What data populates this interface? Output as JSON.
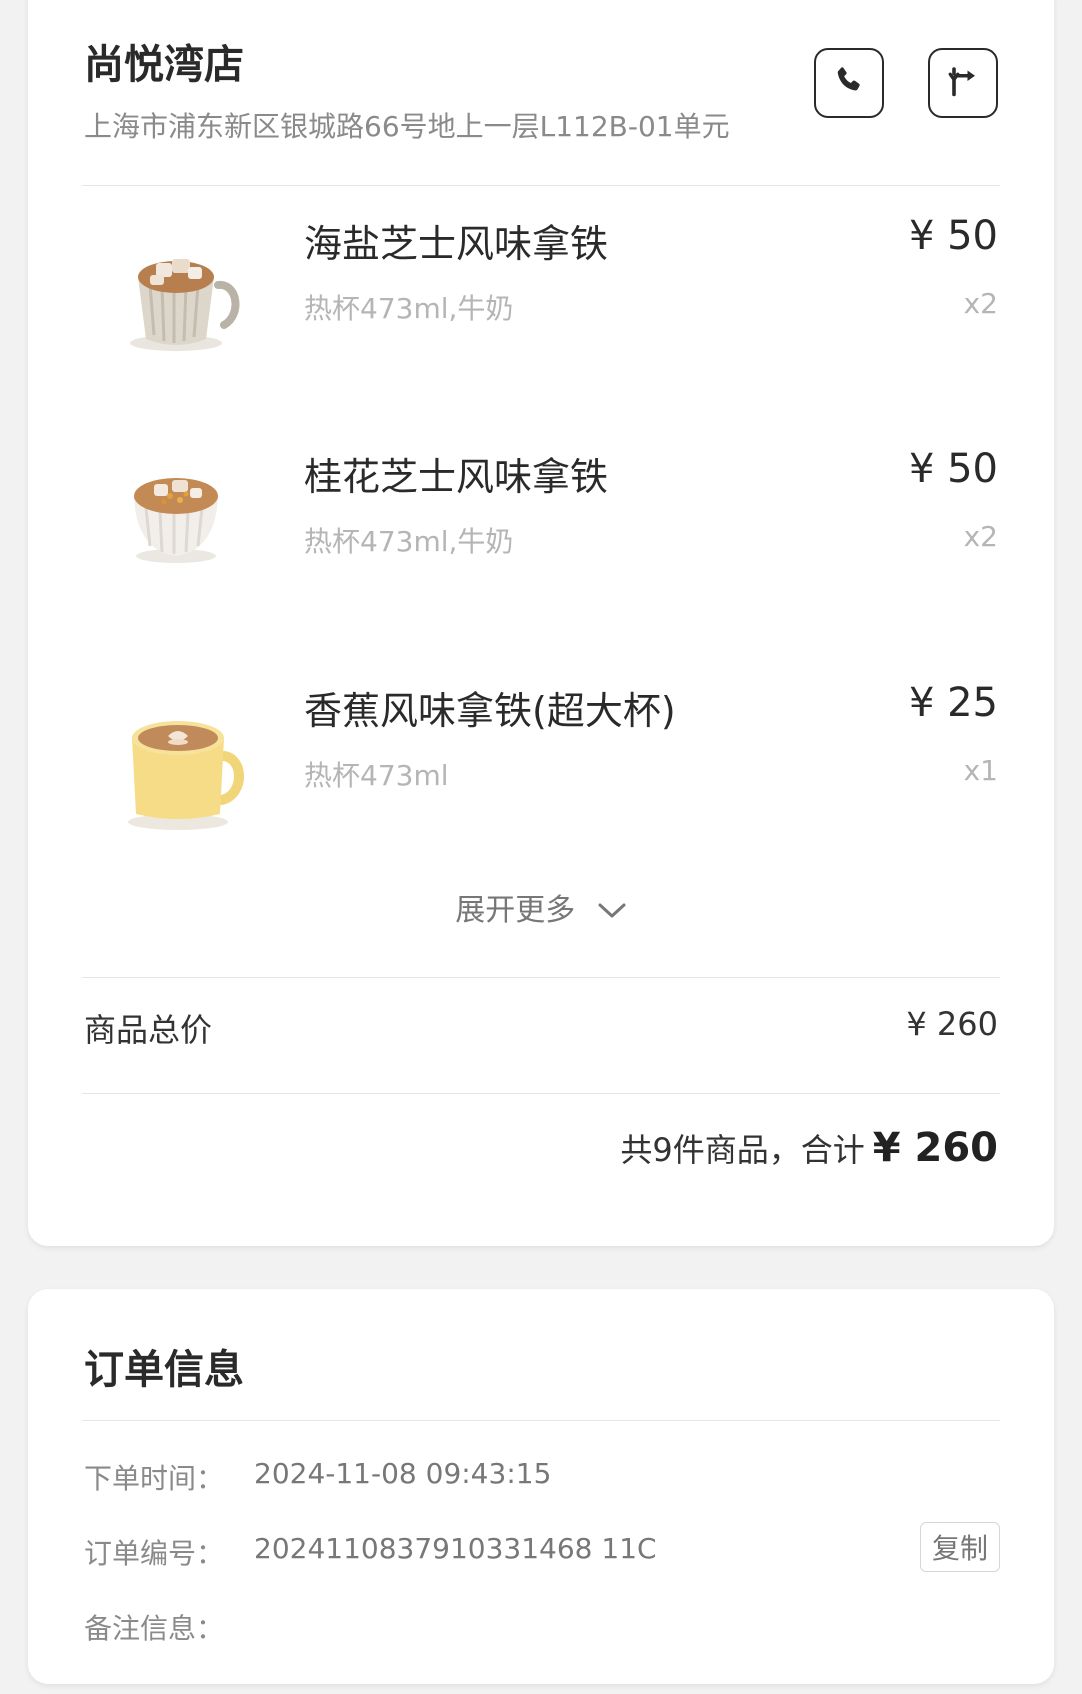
{
  "store": {
    "name": "尚悦湾店",
    "address": "上海市浦东新区银城路66号地上一层L112B-01单元",
    "call_icon": "phone-icon",
    "nav_icon": "navigation-icon"
  },
  "items": [
    {
      "name": "海盐芝士风味拿铁",
      "spec": "热杯473ml,牛奶",
      "price": "¥ 50",
      "qty": "x2",
      "image": "iced-latte-cup"
    },
    {
      "name": "桂花芝士风味拿铁",
      "spec": "热杯473ml,牛奶",
      "price": "¥ 50",
      "qty": "x2",
      "image": "osmanthus-latte-cup"
    },
    {
      "name": "香蕉风味拿铁(超大杯)",
      "spec": "热杯473ml",
      "price": "¥ 25",
      "qty": "x1",
      "image": "yellow-latte-mug"
    }
  ],
  "expand": {
    "label": "展开更多",
    "icon": "chevron-down-icon"
  },
  "subtotal": {
    "label": "商品总价",
    "value": "¥ 260"
  },
  "total": {
    "count_text": "共9件商品，合计",
    "value": "¥ 260"
  },
  "order": {
    "title": "订单信息",
    "time_label": "下单时间：",
    "time_value": "2024-11-08 09:43:15",
    "number_label": "订单编号：",
    "number_value": "2024110837910331468 11C",
    "copy_label": "复制",
    "note_label": "备注信息："
  },
  "colors": {
    "background": "#f2f2f2",
    "card": "#ffffff",
    "text": "#2a2a2a",
    "muted": "#b5b5b5"
  }
}
